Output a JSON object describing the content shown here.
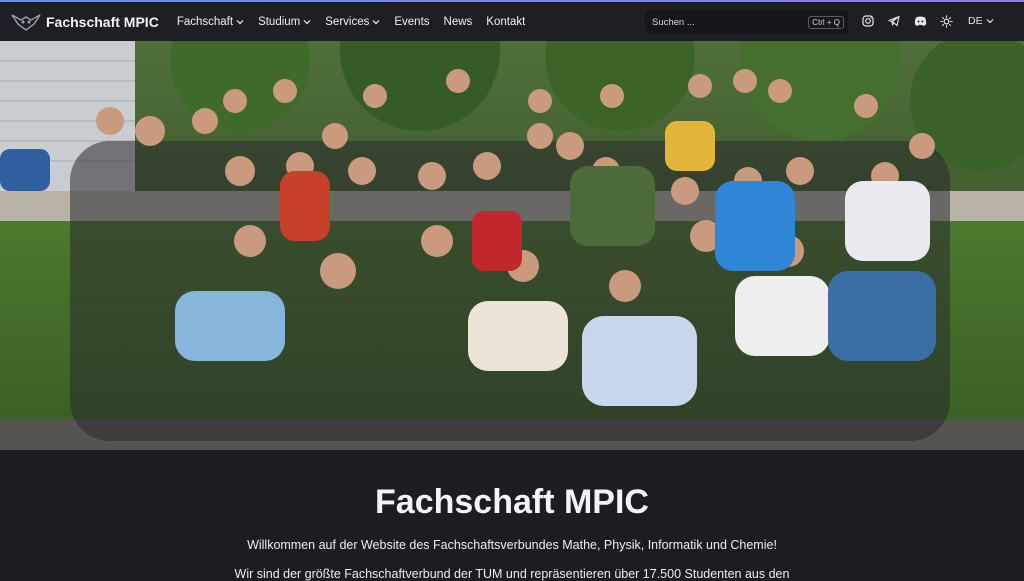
{
  "header": {
    "brand": "Fachschaft MPIC",
    "nav": [
      {
        "label": "Fachschaft",
        "dropdown": true
      },
      {
        "label": "Studium",
        "dropdown": true
      },
      {
        "label": "Services",
        "dropdown": true
      },
      {
        "label": "Events",
        "dropdown": false
      },
      {
        "label": "News",
        "dropdown": false
      },
      {
        "label": "Kontakt",
        "dropdown": false
      }
    ],
    "search": {
      "placeholder": "Suchen ...",
      "shortcut": "Ctrl + Q"
    },
    "social_icons": [
      "instagram-icon",
      "telegram-icon",
      "discord-icon",
      "sun-icon"
    ],
    "language": "DE"
  },
  "hero": {
    "photo_subject": "group-photo"
  },
  "main": {
    "title": "Fachschaft MPIC",
    "intro": "Willkommen auf der Website des Fachschaftsverbundes Mathe, Physik, Informatik und Chemie!",
    "intro_second_line": "Wir sind der größte Fachschaftverbund der TUM und repräsentieren über 17.500 Studenten aus den"
  },
  "colors": {
    "header_bg": "#1d1f24",
    "page_bg": "#1b1d22",
    "accent": "#6a8cff"
  }
}
